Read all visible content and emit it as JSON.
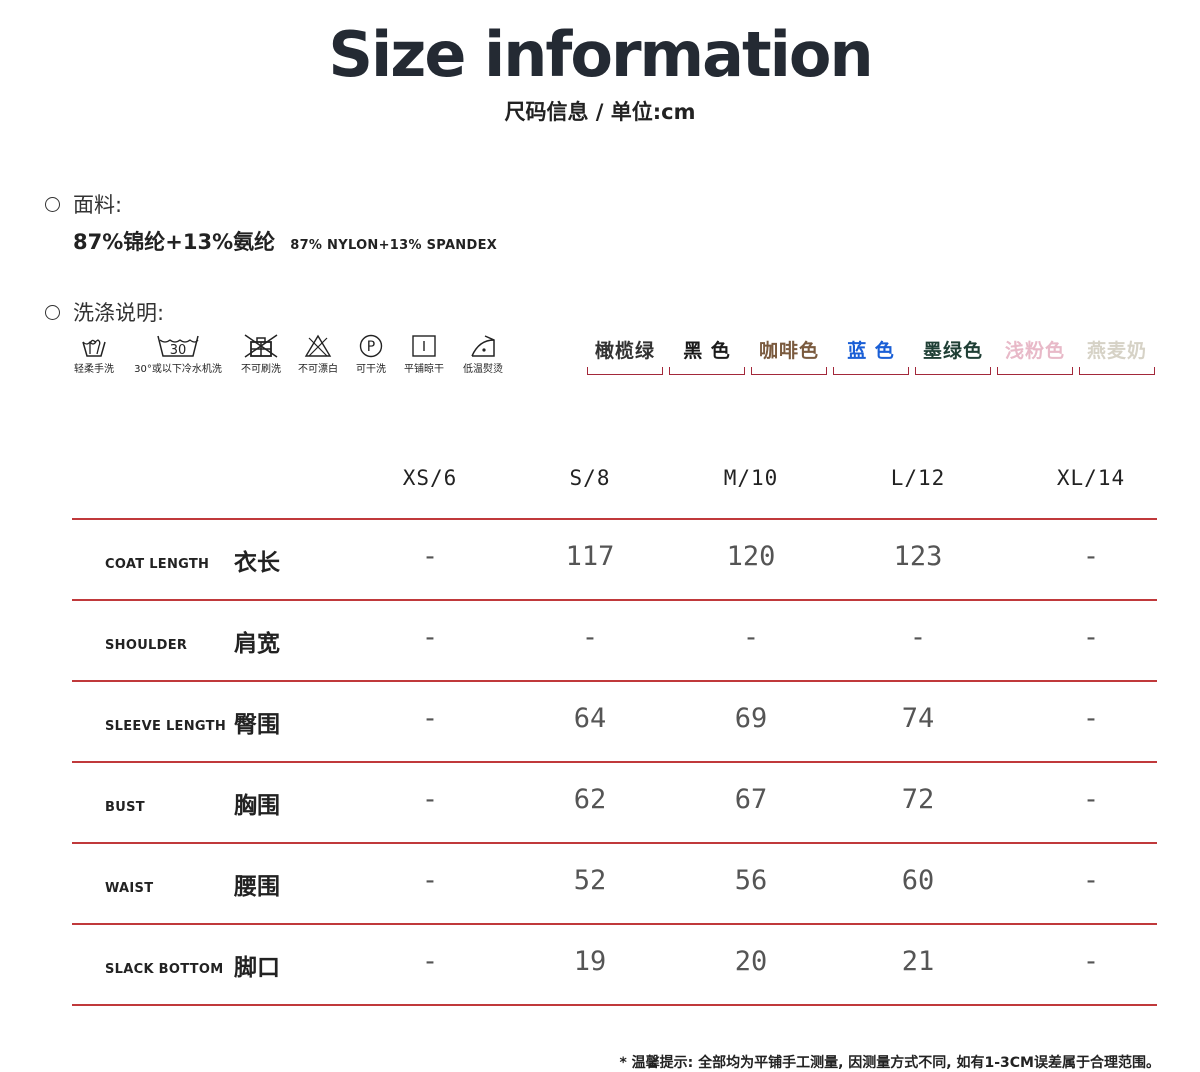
{
  "header": {
    "title": "Size information",
    "subtitle": "尺码信息 / 单位:cm"
  },
  "fabric": {
    "label": "面料:",
    "composition_cn": "87%锦纶+13%氨纶",
    "composition_en": "87% NYLON+13% SPANDEX"
  },
  "care": {
    "label": "洗涤说明:",
    "items": [
      {
        "icon": "hand-wash-icon",
        "label": "轻柔手洗"
      },
      {
        "icon": "machine-wash-30-icon",
        "label": "30°或以下冷水机洗",
        "icon_text": "30"
      },
      {
        "icon": "no-brush-icon",
        "label": "不可刷洗"
      },
      {
        "icon": "no-bleach-icon",
        "label": "不可漂白"
      },
      {
        "icon": "dry-clean-p-icon",
        "label": "可干洗",
        "icon_text": "P"
      },
      {
        "icon": "dry-flat-icon",
        "label": "平铺晾干"
      },
      {
        "icon": "iron-low-icon",
        "label": "低温熨烫"
      }
    ]
  },
  "colors": [
    {
      "name": "橄榄绿",
      "color": "#333333"
    },
    {
      "name": "黑 色",
      "color": "#1a1a1a"
    },
    {
      "name": "咖啡色",
      "color": "#7a5a3e"
    },
    {
      "name": "蓝 色",
      "color": "#1a5fd6"
    },
    {
      "name": "墨绿色",
      "color": "#1f3f35"
    },
    {
      "name": "浅粉色",
      "color": "#e8b9c8"
    },
    {
      "name": "燕麦奶",
      "color": "#d6d2c6"
    }
  ],
  "table": {
    "columns": [
      "XS/6",
      "S/8",
      "M/10",
      "L/12",
      "XL/14"
    ],
    "rows": [
      {
        "en": "COAT LENGTH",
        "cn": "衣长",
        "values": [
          "-",
          "117",
          "120",
          "123",
          "-"
        ]
      },
      {
        "en": "SHOULDER",
        "cn": "肩宽",
        "values": [
          "-",
          "-",
          "-",
          "-",
          "-"
        ]
      },
      {
        "en": "SLEEVE LENGTH",
        "cn": "臀围",
        "values": [
          "-",
          "64",
          "69",
          "74",
          "-"
        ]
      },
      {
        "en": "BUST",
        "cn": "胸围",
        "values": [
          "-",
          "62",
          "67",
          "72",
          "-"
        ]
      },
      {
        "en": "WAIST",
        "cn": "腰围",
        "values": [
          "-",
          "52",
          "56",
          "60",
          "-"
        ]
      },
      {
        "en": "SLACK BOTTOM",
        "cn": "脚口",
        "values": [
          "-",
          "19",
          "20",
          "21",
          "-"
        ]
      }
    ]
  },
  "accent_color": "#c0393b",
  "footnote": "* 温馨提示: 全部均为平铺手工测量, 因测量方式不同, 如有1-3CM误差属于合理范围。"
}
